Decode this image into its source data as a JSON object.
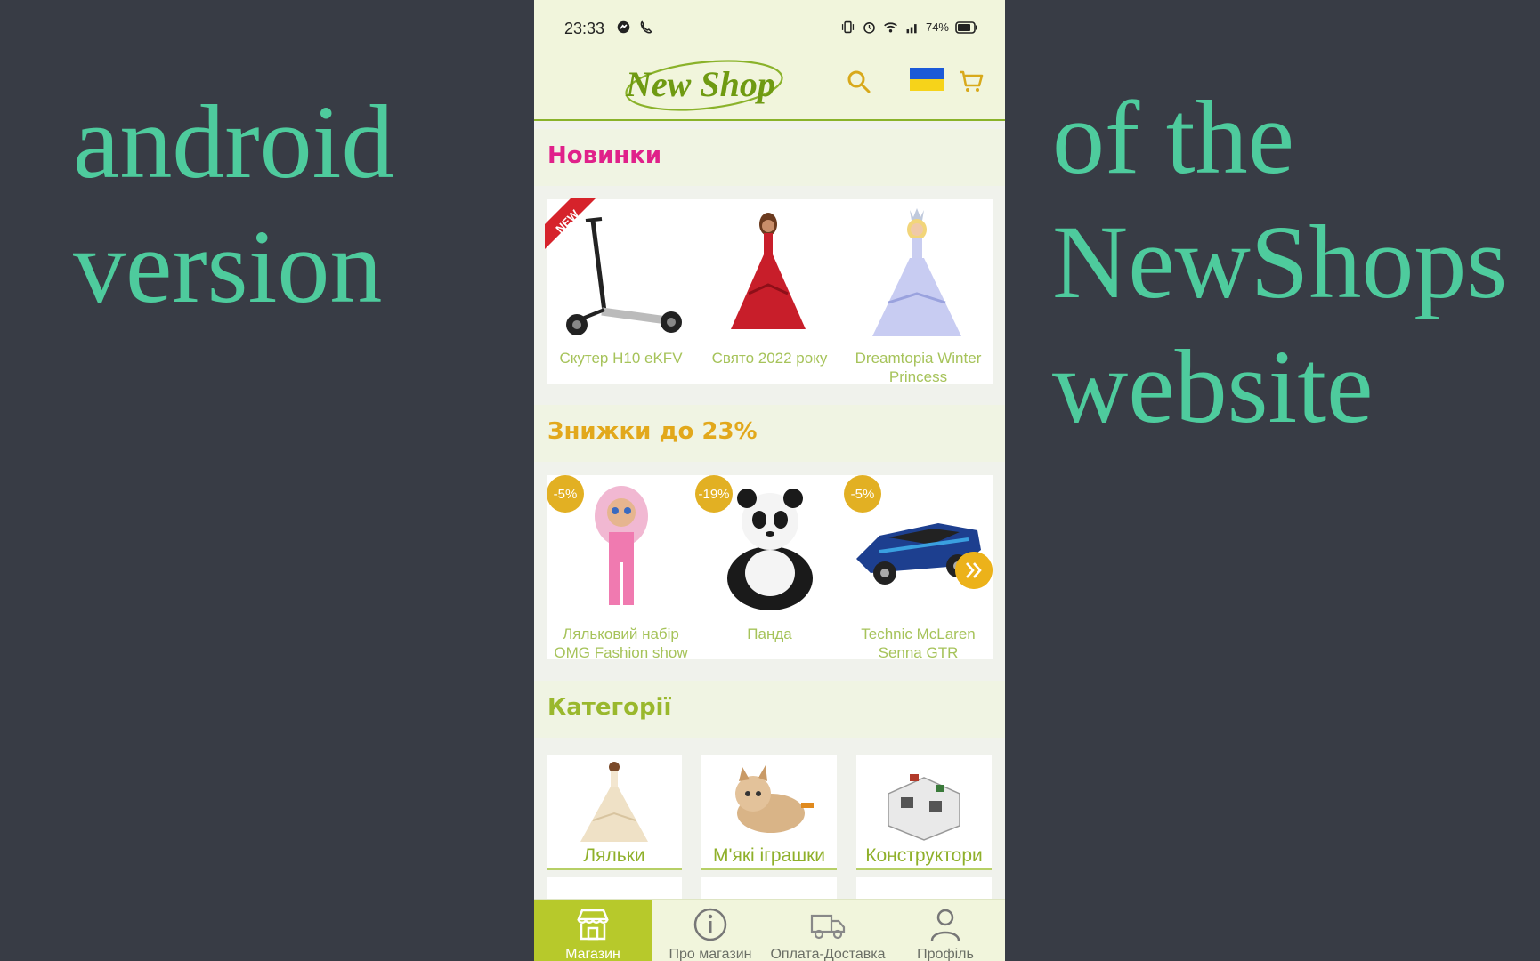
{
  "overlay": {
    "left_lines": [
      "android",
      "version"
    ],
    "right_lines": [
      "of the",
      "NewShops",
      "website"
    ]
  },
  "status_bar": {
    "time": "23:33",
    "battery": "74%",
    "icons": [
      "messenger-icon",
      "phone-call-icon",
      "vibrate-icon",
      "alarm-icon",
      "wifi-icon",
      "signal-icon",
      "battery-icon"
    ]
  },
  "header": {
    "logo_text": "New Shop",
    "icons": [
      "search-icon",
      "ukraine-flag",
      "cart-icon"
    ]
  },
  "new_arrivals": {
    "title": "Новинки",
    "badge": "NEW",
    "products": [
      {
        "name": "Скутер H10 eKFV"
      },
      {
        "name": "Свято 2022 року"
      },
      {
        "name": "Dreamtopia Winter Princess"
      }
    ]
  },
  "discounts": {
    "title": "Знижки до 23%",
    "products": [
      {
        "name": "Ляльковий набір OMG Fashion show",
        "discount": "-5%"
      },
      {
        "name": "Панда",
        "discount": "-19%"
      },
      {
        "name": "Technic McLaren Senna GTR",
        "discount": "-5%"
      }
    ]
  },
  "categories": {
    "title": "Категорії",
    "items": [
      {
        "name": "Ляльки"
      },
      {
        "name": "М'які іграшки"
      },
      {
        "name": "Конструктори"
      }
    ]
  },
  "bottom_nav": {
    "items": [
      {
        "label": "Магазин",
        "icon": "store-icon",
        "active": true
      },
      {
        "label": "Про магазин",
        "icon": "info-icon",
        "active": false
      },
      {
        "label": "Оплата-Доставка",
        "icon": "delivery-truck-icon",
        "active": false
      },
      {
        "label": "Профіль",
        "icon": "profile-icon",
        "active": false
      }
    ]
  },
  "colors": {
    "background": "#383c45",
    "overlay_text": "#4ecb9d",
    "header_bg": "#f1f5dc",
    "accent_green": "#b7c92b",
    "new_title": "#e0218a",
    "discount_title": "#e2a81c",
    "category_title": "#9ab82d"
  }
}
